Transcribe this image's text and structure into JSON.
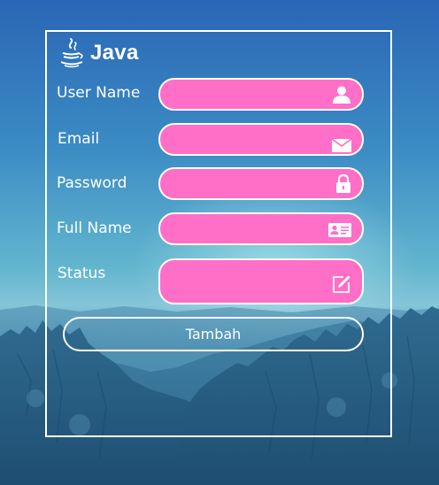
{
  "app": {
    "logo_text": "Java",
    "logo_icon": "java-coffee-cup-icon"
  },
  "form": {
    "fields": [
      {
        "label": "User Name",
        "value": "",
        "icon": "user-icon"
      },
      {
        "label": "Email",
        "value": "",
        "icon": "envelope-icon"
      },
      {
        "label": "Password",
        "value": "",
        "icon": "lock-icon"
      },
      {
        "label": "Full Name",
        "value": "",
        "icon": "id-card-icon"
      },
      {
        "label": "Status",
        "value": "",
        "icon": "edit-icon"
      }
    ],
    "submit_label": "Tambah"
  },
  "colors": {
    "field_fill": "#FF6EC7",
    "border": "#FFFFFF",
    "text": "#FFFFFF",
    "sky_top": "#2A66B5",
    "mountain": "#2F6F98"
  }
}
